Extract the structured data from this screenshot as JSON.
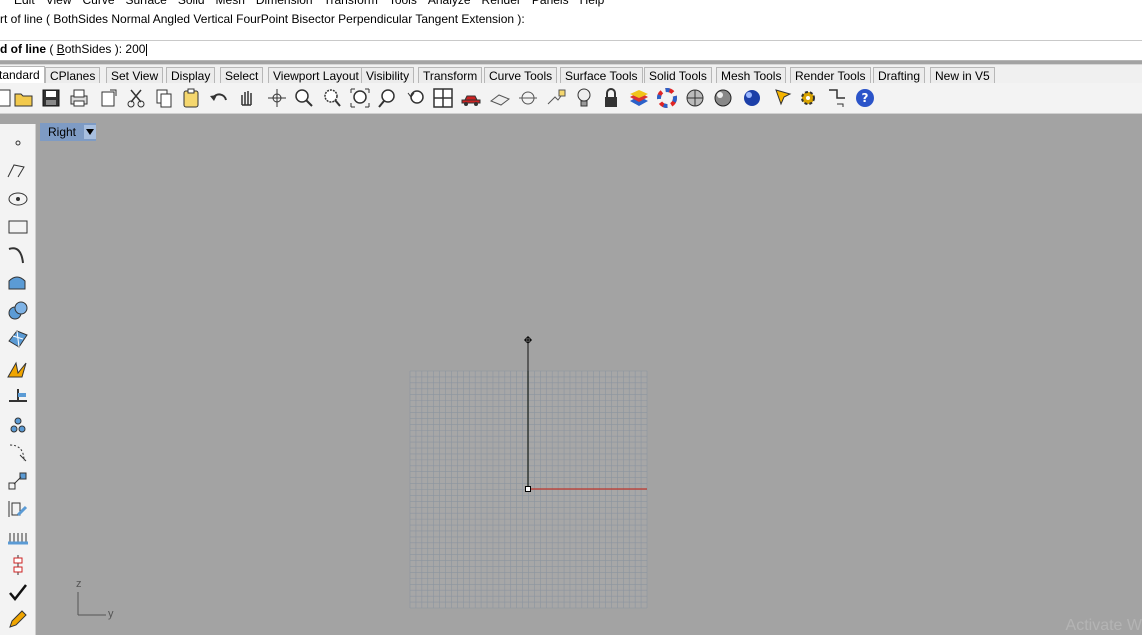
{
  "menu": [
    "Edit",
    "View",
    "Curve",
    "Surface",
    "Solid",
    "Mesh",
    "Dimension",
    "Transform",
    "Tools",
    "Analyze",
    "Render",
    "Panels",
    "Help"
  ],
  "command": {
    "history": "rt of line ( BothSides  Normal  Angled  Vertical  FourPoint  Bisector  Perpendicular  Tangent  Extension ):",
    "prompt_bold": "d of line",
    "prompt_open": " ( ",
    "prompt_option_first": "B",
    "prompt_option_rest": "othSides",
    "prompt_close": " ): ",
    "input_value": "200"
  },
  "tabs": [
    "tandard",
    "CPlanes",
    "Set View",
    "Display",
    "Select",
    "Viewport Layout",
    "Visibility",
    "Transform",
    "Curve Tools",
    "Surface Tools",
    "Solid Tools",
    "Mesh Tools",
    "Render Tools",
    "Drafting",
    "New in V5"
  ],
  "toolbar": {
    "icons": [
      "new-icon",
      "open-icon",
      "save-icon",
      "print-icon",
      "import-icon",
      "cut-icon",
      "copy-icon",
      "paste-icon",
      "undo-icon",
      "pan-hand-icon",
      "rotate-view-icon",
      "zoom-dynamic-icon",
      "zoom-window-icon",
      "zoom-extents-icon",
      "zoom-selected-icon",
      "undo-view-icon",
      "four-viewports-icon",
      "car-icon",
      "cplane-icon",
      "named-cplane-icon",
      "named-view-icon",
      "light-bulb-icon",
      "lock-icon",
      "layers-icon",
      "color-wheel-icon",
      "shaded-sphere-icon",
      "rendered-sphere-icon",
      "render-sphere-icon",
      "blue-sphere-icon",
      "select-filter-icon",
      "options-gear-icon",
      "snap-icon",
      "help-icon"
    ]
  },
  "left_toolbar": {
    "icons": [
      "point-icon",
      "polyline-icon",
      "circle-icon",
      "rectangle-icon",
      "curve-icon",
      "surface-icon",
      "solid-icon",
      "mesh-icon",
      "explode-icon",
      "dimension-icon",
      "group-icon",
      "fillet-icon",
      "transform-icon",
      "analysis-icon",
      "grid-icon",
      "align-icon",
      "check-icon",
      "edit-icon"
    ]
  },
  "viewport": {
    "name": "Right",
    "axis_z": "z",
    "axis_y": "y"
  },
  "watermark": "Activate W",
  "colors": {
    "viewport_bg": "#a3a3a3",
    "grid_line": "#8c95a0",
    "x_axis": "#c0352b",
    "active_tab": "#7e9bc4"
  }
}
